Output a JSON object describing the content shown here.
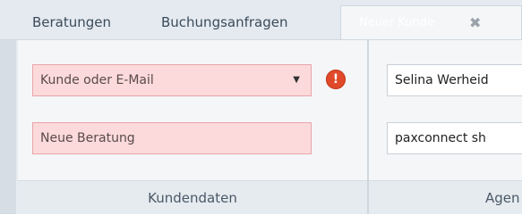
{
  "tabs": [
    {
      "label": "Beratungen"
    },
    {
      "label": "Buchungsanfragen"
    },
    {
      "label": "Neuer Kunde",
      "active": true
    }
  ],
  "close_icon_glyph": "✖",
  "customer": {
    "combo_placeholder": "Kunde oder E-Mail",
    "dropdown_glyph": "▼",
    "error_glyph": "!",
    "consultation_placeholder": "Neue Beratung",
    "group_label": "Kundendaten"
  },
  "agent": {
    "name_value": "Selina Werheid",
    "shop_value": "paxconnect sh",
    "group_label": "Agen"
  },
  "colors": {
    "error_field_bg": "#fcdadb",
    "error_badge": "#e04a2a",
    "tabstrip_bg": "#e4eaf0"
  }
}
